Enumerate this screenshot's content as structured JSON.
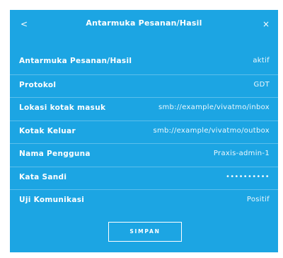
{
  "dialog": {
    "title": "Antarmuka Pesanan/Hasil",
    "back_icon": "<",
    "close_icon": "×",
    "save_label": "SIMPAN",
    "accent_color": "#1ca5e3"
  },
  "rows": [
    {
      "label": "Antarmuka Pesanan/Hasil",
      "value": "aktif"
    },
    {
      "label": "Protokol",
      "value": "GDT"
    },
    {
      "label": "Lokasi kotak masuk",
      "value": "smb://example/vivatmo/inbox"
    },
    {
      "label": "Kotak Keluar",
      "value": "smb://example/vivatmo/outbox"
    },
    {
      "label": "Nama Pengguna",
      "value": "Praxis-admin-1"
    },
    {
      "label": "Kata Sandi",
      "value": "••••••••••"
    },
    {
      "label": "Uji Komunikasi",
      "value": "Positif"
    }
  ]
}
